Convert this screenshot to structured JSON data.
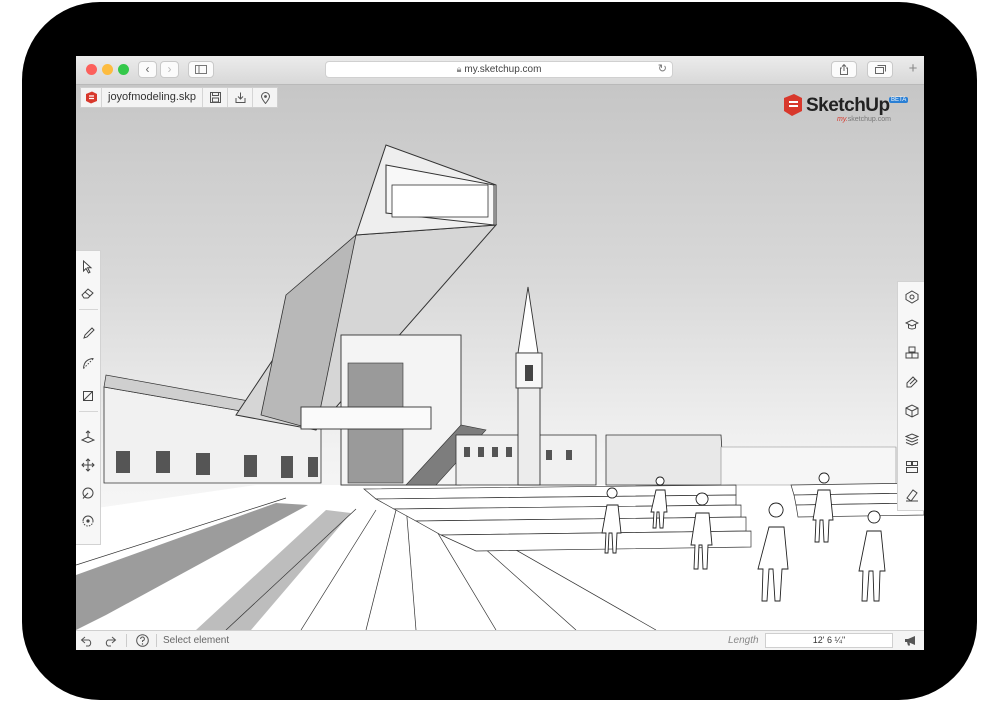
{
  "browser": {
    "url": "my.sketchup.com",
    "traffic_colors": [
      "#fc605c",
      "#fdbc40",
      "#34c84a"
    ]
  },
  "app": {
    "file_name": "joyofmodeling.skp",
    "brand": {
      "name": "SketchUp",
      "badge": "BETA",
      "sub_prefix": "my.",
      "sub_rest": "sketchup.com"
    },
    "left_tools": [
      "select-icon",
      "eraser-icon",
      "pencil-icon",
      "arc-icon",
      "shape-icon",
      "push-pull-icon",
      "move-icon",
      "tape-measure-icon",
      "orbit-icon"
    ],
    "right_tools": [
      "entity-info-icon",
      "instructor-icon",
      "components-icon",
      "materials-icon",
      "styles-icon",
      "layers-icon",
      "scenes-icon",
      "outliner-icon"
    ],
    "status": {
      "message": "Select element",
      "length_label": "Length",
      "length_value": "12' 6 ¼\""
    },
    "accent_red": "#d8382c"
  }
}
